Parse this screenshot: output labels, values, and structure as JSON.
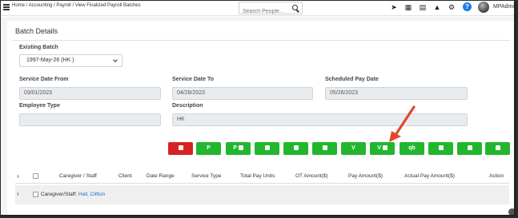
{
  "nav": {
    "breadcrumb": "Home / Accounting / Payroll / View Finalized Payroll Batches",
    "search_placeholder": "Search People...",
    "user_name": "MPAdmi",
    "help_label": "?"
  },
  "page": {
    "title": "Batch Details",
    "existing_batch_label": "Existing Batch",
    "existing_batch_value": "1997-May-26 (HK )",
    "service_date_from_label": "Service Date From",
    "service_date_from_value": "03/01/2023",
    "service_date_to_label": "Service Date To",
    "service_date_to_value": "04/28/2023",
    "scheduled_pay_date_label": "Scheduled Pay Date",
    "scheduled_pay_date_value": "05/26/2023",
    "employee_type_label": "Employee Type",
    "employee_type_value": "",
    "description_label": "Description",
    "description_value": "HK"
  },
  "actions": [
    {
      "label": "",
      "icon": "trash-icon",
      "color": "#d62222"
    },
    {
      "label": "P",
      "icon": ""
    },
    {
      "label": "P",
      "icon": "lock-icon"
    },
    {
      "label": "",
      "icon": "card-icon"
    },
    {
      "label": "",
      "icon": "document-icon"
    },
    {
      "label": "",
      "icon": "download-icon"
    },
    {
      "label": "V",
      "icon": ""
    },
    {
      "label": "V",
      "icon": "lock-icon"
    },
    {
      "label": "qb",
      "icon": ""
    },
    {
      "label": "",
      "icon": "user-edit-icon"
    },
    {
      "label": "",
      "icon": "clock-icon"
    },
    {
      "label": "",
      "icon": "print-icon"
    }
  ],
  "table": {
    "headers": [
      "Caregiver / Staff",
      "Client",
      "Date Range",
      "Service Type",
      "Total Pay Units",
      "OT Amount($)",
      "Pay Amount($)",
      "Actual Pay Amount($)",
      "Action"
    ],
    "rows": [
      {
        "prefix": "Caregiver/Staff:",
        "name": "Hall, Clifton"
      }
    ]
  },
  "colors": {
    "accent_green": "#22b62f",
    "danger_red": "#d62222",
    "link_blue": "#1e6fd9",
    "arrow_red": "#e04a2a"
  }
}
